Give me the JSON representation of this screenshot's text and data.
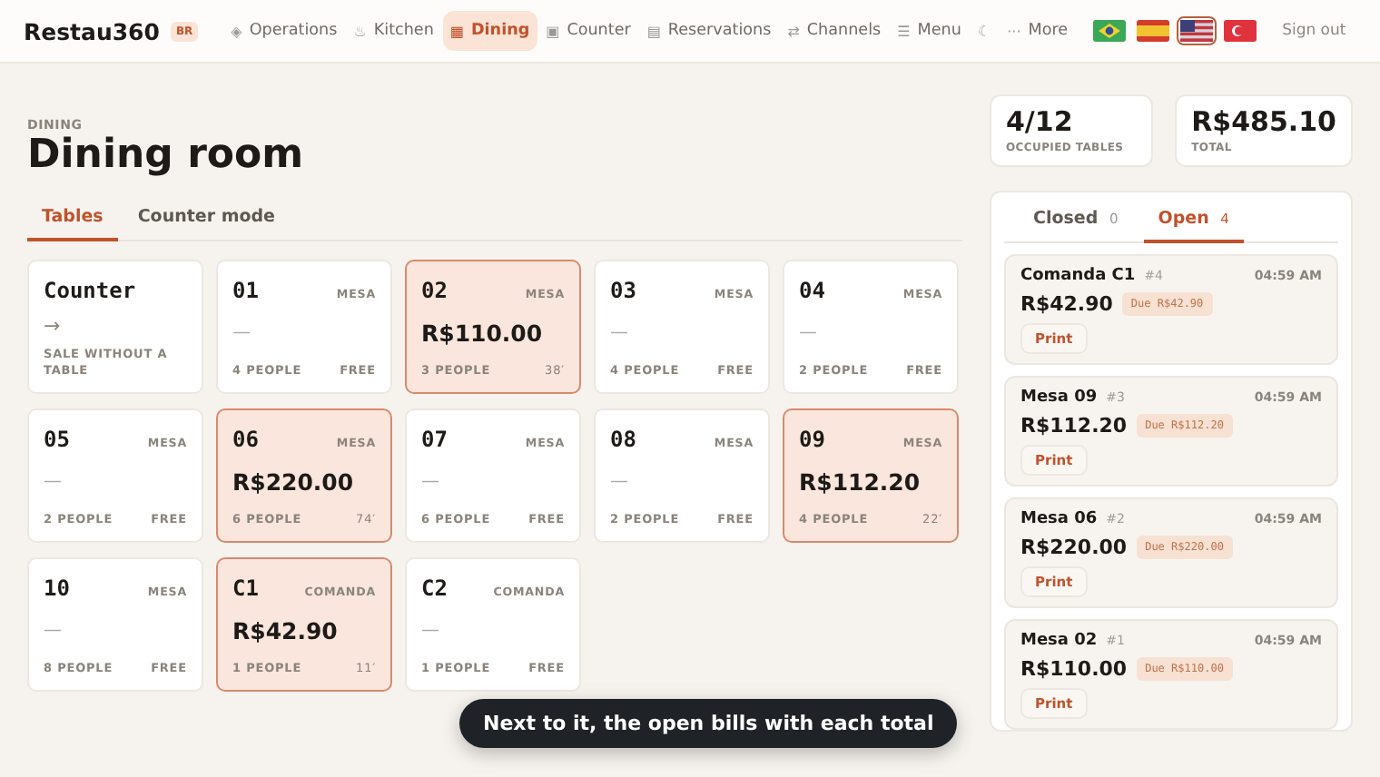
{
  "header": {
    "logo": "Restau360",
    "badge": "BR",
    "nav": [
      {
        "glyph": "◈",
        "label": "Operations",
        "selected": false
      },
      {
        "glyph": "♨",
        "label": "Kitchen",
        "selected": false
      },
      {
        "glyph": "▦",
        "label": "Dining",
        "selected": true
      },
      {
        "glyph": "▣",
        "label": "Counter",
        "selected": false
      },
      {
        "glyph": "▤",
        "label": "Reservations",
        "selected": false
      },
      {
        "glyph": "⇄",
        "label": "Channels",
        "selected": false
      },
      {
        "glyph": "☰",
        "label": "Menu",
        "selected": false
      },
      {
        "glyph": "☾",
        "selected": false
      },
      {
        "glyph": "···",
        "label": "More",
        "selected": false
      }
    ],
    "languages": [
      {
        "kind": "br",
        "selected": false
      },
      {
        "kind": "es",
        "selected": false
      },
      {
        "kind": "us",
        "selected": true
      },
      {
        "kind": "tr",
        "selected": false
      }
    ],
    "sign_out": "Sign out"
  },
  "page": {
    "eyebrow": "DINING",
    "title": "Dining room",
    "tabs": [
      {
        "label": "Tables",
        "selected": true
      },
      {
        "label": "Counter mode",
        "selected": false
      }
    ],
    "tables": [
      {
        "kind": "counter",
        "name": "Counter",
        "arrow": "→",
        "caption": "SALE WITHOUT A TABLE"
      },
      {
        "kind": "table",
        "name": "01",
        "type": "MESA",
        "occupied": false,
        "amount": "—",
        "people": "4 PEOPLE",
        "status": "FREE"
      },
      {
        "kind": "table",
        "name": "02",
        "type": "MESA",
        "occupied": true,
        "amount": "R$110.00",
        "people": "3 PEOPLE",
        "status": "38′"
      },
      {
        "kind": "table",
        "name": "03",
        "type": "MESA",
        "occupied": false,
        "amount": "—",
        "people": "4 PEOPLE",
        "status": "FREE"
      },
      {
        "kind": "table",
        "name": "04",
        "type": "MESA",
        "occupied": false,
        "amount": "—",
        "people": "2 PEOPLE",
        "status": "FREE"
      },
      {
        "kind": "table",
        "name": "05",
        "type": "MESA",
        "occupied": false,
        "amount": "—",
        "people": "2 PEOPLE",
        "status": "FREE"
      },
      {
        "kind": "table",
        "name": "06",
        "type": "MESA",
        "occupied": true,
        "amount": "R$220.00",
        "people": "6 PEOPLE",
        "status": "74′"
      },
      {
        "kind": "table",
        "name": "07",
        "type": "MESA",
        "occupied": false,
        "amount": "—",
        "people": "6 PEOPLE",
        "status": "FREE"
      },
      {
        "kind": "table",
        "name": "08",
        "type": "MESA",
        "occupied": false,
        "amount": "—",
        "people": "2 PEOPLE",
        "status": "FREE"
      },
      {
        "kind": "table",
        "name": "09",
        "type": "MESA",
        "occupied": true,
        "amount": "R$112.20",
        "people": "4 PEOPLE",
        "status": "22′"
      },
      {
        "kind": "table",
        "name": "10",
        "type": "MESA",
        "occupied": false,
        "amount": "—",
        "people": "8 PEOPLE",
        "status": "FREE"
      },
      {
        "kind": "table",
        "name": "C1",
        "type": "COMANDA",
        "occupied": true,
        "amount": "R$42.90",
        "people": "1 PEOPLE",
        "status": "11′"
      },
      {
        "kind": "table",
        "name": "C2",
        "type": "COMANDA",
        "occupied": false,
        "amount": "—",
        "people": "1 PEOPLE",
        "status": "FREE"
      }
    ]
  },
  "stats": [
    {
      "value": "4/12",
      "label": "OCCUPIED TABLES"
    },
    {
      "value": "R$485.10",
      "label": "TOTAL"
    }
  ],
  "bills": {
    "tabs": [
      {
        "label": "Closed",
        "count": "0",
        "selected": false
      },
      {
        "label": "Open",
        "count": "4",
        "selected": true
      }
    ],
    "items": [
      {
        "title": "Comanda C1",
        "number": "#4",
        "time": "04:59 AM",
        "amount": "R$42.90",
        "due": "Due R$42.90",
        "action": "Print"
      },
      {
        "title": "Mesa 09",
        "number": "#3",
        "time": "04:59 AM",
        "amount": "R$112.20",
        "due": "Due R$112.20",
        "action": "Print"
      },
      {
        "title": "Mesa 06",
        "number": "#2",
        "time": "04:59 AM",
        "amount": "R$220.00",
        "due": "Due R$220.00",
        "action": "Print"
      },
      {
        "title": "Mesa 02",
        "number": "#1",
        "time": "04:59 AM",
        "amount": "R$110.00",
        "due": "Due R$110.00",
        "action": "Print"
      }
    ]
  },
  "toast": "Next to it, the open bills with each total"
}
